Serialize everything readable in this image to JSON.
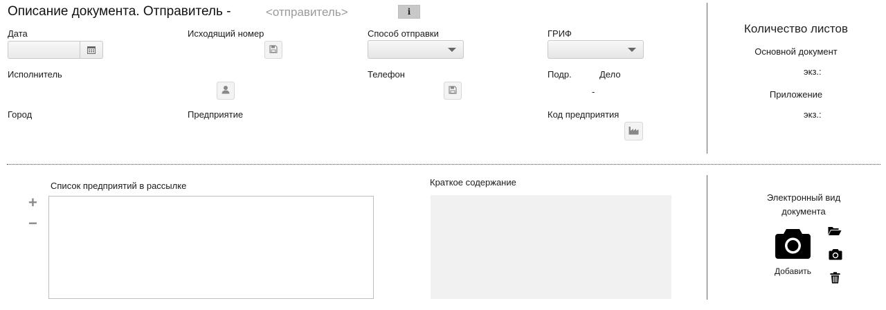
{
  "header": {
    "title": "Описание документа. Отправитель -",
    "sender_placeholder": "<отправитель>",
    "info_label": "i"
  },
  "fields": {
    "date_label": "Дата",
    "outgoing_number_label": "Исходящий номер",
    "delivery_method_label": "Способ отправки",
    "grif_label": "ГРИФ",
    "executor_label": "Исполнитель",
    "phone_label": "Телефон",
    "subdivision_label": "Подр.",
    "case_label": "Дело",
    "case_separator": "-",
    "city_label": "Город",
    "enterprise_label": "Предприятие",
    "enterprise_code_label": "Код предприятия"
  },
  "sheets": {
    "title": "Количество листов",
    "main_document_label": "Основной документ",
    "main_copies_label": "экз.:",
    "attachment_label": "Приложение",
    "attachment_copies_label": "экз.:"
  },
  "mailing": {
    "title": "Список предприятий в рассылке",
    "add_symbol": "+",
    "remove_symbol": "−"
  },
  "summary": {
    "title": "Краткое содержание"
  },
  "electronic": {
    "title_line1": "Электронный вид",
    "title_line2": "документа",
    "add_label": "Добавить"
  },
  "icons": {
    "calendar": "calendar-icon",
    "save": "save-icon",
    "user": "user-icon",
    "factory": "factory-icon",
    "camera": "camera-icon",
    "folder_open": "folder-open-icon",
    "trash": "trash-icon"
  }
}
